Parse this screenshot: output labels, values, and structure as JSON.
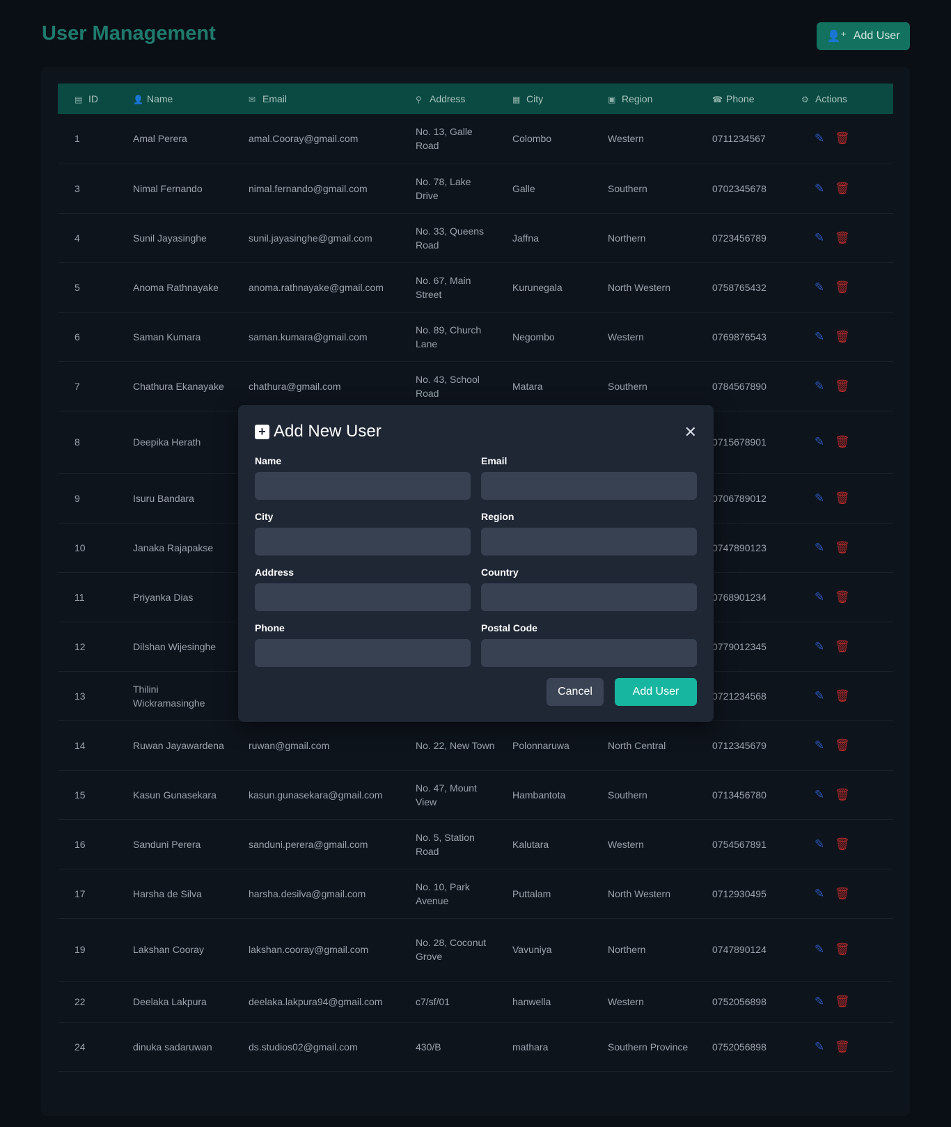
{
  "header": {
    "title": "User Management",
    "add_user_label": "Add User"
  },
  "table": {
    "columns": [
      "ID",
      "Name",
      "Email",
      "Address",
      "City",
      "Region",
      "Phone",
      "Actions"
    ],
    "column_icons": [
      "id-card-icon",
      "user-icon",
      "envelope-icon",
      "map-pin-icon",
      "city-icon",
      "map-icon",
      "phone-icon",
      "gears-icon"
    ],
    "rows": [
      {
        "id": "1",
        "name": "Amal Perera",
        "email": "amal.Cooray@gmail.com",
        "address": "No. 13, Galle Road",
        "city": "Colombo",
        "region": "Western",
        "phone": "0711234567"
      },
      {
        "id": "3",
        "name": "Nimal Fernando",
        "email": "nimal.fernando@gmail.com",
        "address": "No. 78, Lake Drive",
        "city": "Galle",
        "region": "Southern",
        "phone": "0702345678"
      },
      {
        "id": "4",
        "name": "Sunil Jayasinghe",
        "email": "sunil.jayasinghe@gmail.com",
        "address": "No. 33, Queens Road",
        "city": "Jaffna",
        "region": "Northern",
        "phone": "0723456789"
      },
      {
        "id": "5",
        "name": "Anoma Rathnayake",
        "email": "anoma.rathnayake@gmail.com",
        "address": "No. 67, Main Street",
        "city": "Kurunegala",
        "region": "North Western",
        "phone": "0758765432"
      },
      {
        "id": "6",
        "name": "Saman Kumara",
        "email": "saman.kumara@gmail.com",
        "address": "No. 89, Church Lane",
        "city": "Negombo",
        "region": "Western",
        "phone": "0769876543"
      },
      {
        "id": "7",
        "name": "Chathura Ekanayake",
        "email": "chathura@gmail.com",
        "address": "No. 43, School Road",
        "city": "Matara",
        "region": "Southern",
        "phone": "0784567890"
      },
      {
        "id": "8",
        "name": "Deepika Herath",
        "email": "",
        "address": "",
        "city": "",
        "region": "",
        "phone": "0715678901"
      },
      {
        "id": "9",
        "name": "Isuru Bandara",
        "email": "",
        "address": "",
        "city": "",
        "region": "",
        "phone": "0706789012"
      },
      {
        "id": "10",
        "name": "Janaka Rajapakse",
        "email": "",
        "address": "",
        "city": "",
        "region": "",
        "phone": "0747890123"
      },
      {
        "id": "11",
        "name": "Priyanka Dias",
        "email": "",
        "address": "",
        "city": "",
        "region": "",
        "phone": "0768901234"
      },
      {
        "id": "12",
        "name": "Dilshan Wijesinghe",
        "email": "",
        "address": "",
        "city": "",
        "region": "",
        "phone": "0779012345"
      },
      {
        "id": "13",
        "name": "Thilini Wickramasinghe",
        "email": "",
        "address": "",
        "city": "",
        "region": "",
        "phone": "0721234568"
      },
      {
        "id": "14",
        "name": "Ruwan Jayawardena",
        "email": "ruwan@gmail.com",
        "address": "No. 22, New Town",
        "city": "Polonnaruwa",
        "region": "North Central",
        "phone": "0712345679"
      },
      {
        "id": "15",
        "name": "Kasun Gunasekara",
        "email": "kasun.gunasekara@gmail.com",
        "address": "No. 47, Mount View",
        "city": "Hambantota",
        "region": "Southern",
        "phone": "0713456780"
      },
      {
        "id": "16",
        "name": "Sanduni Perera",
        "email": "sanduni.perera@gmail.com",
        "address": "No. 5, Station Road",
        "city": "Kalutara",
        "region": "Western",
        "phone": "0754567891"
      },
      {
        "id": "17",
        "name": "Harsha de Silva",
        "email": "harsha.desilva@gmail.com",
        "address": "No. 10, Park Avenue",
        "city": "Puttalam",
        "region": "North Western",
        "phone": "0712930495"
      },
      {
        "id": "19",
        "name": "Lakshan Cooray",
        "email": "lakshan.cooray@gmail.com",
        "address": "No. 28, Coconut Grove",
        "city": "Vavuniya",
        "region": "Northern",
        "phone": "0747890124"
      },
      {
        "id": "22",
        "name": "Deelaka Lakpura",
        "email": "deelaka.lakpura94@gmail.com",
        "address": "c7/sf/01",
        "city": "hanwella",
        "region": "Western",
        "phone": "0752056898"
      },
      {
        "id": "24",
        "name": "dinuka sadaruwan",
        "email": "ds.studios02@gmail.com",
        "address": "430/B",
        "city": "mathara",
        "region": "Southern Province",
        "phone": "0752056898"
      }
    ]
  },
  "modal": {
    "title": "Add New User",
    "fields": {
      "name": {
        "label": "Name",
        "value": ""
      },
      "email": {
        "label": "Email",
        "value": ""
      },
      "city": {
        "label": "City",
        "value": ""
      },
      "region": {
        "label": "Region",
        "value": ""
      },
      "address": {
        "label": "Address",
        "value": ""
      },
      "country": {
        "label": "Country",
        "value": ""
      },
      "phone": {
        "label": "Phone",
        "value": ""
      },
      "postal": {
        "label": "Postal Code",
        "value": ""
      }
    },
    "cancel_label": "Cancel",
    "submit_label": "Add User"
  },
  "colors": {
    "background": "#0a0f16",
    "accent": "#1f7a6c",
    "header_row": "#0a4a43",
    "primary_button": "#17b6a0",
    "edit_icon": "#2a56b8",
    "delete_icon": "#b02a2a"
  }
}
